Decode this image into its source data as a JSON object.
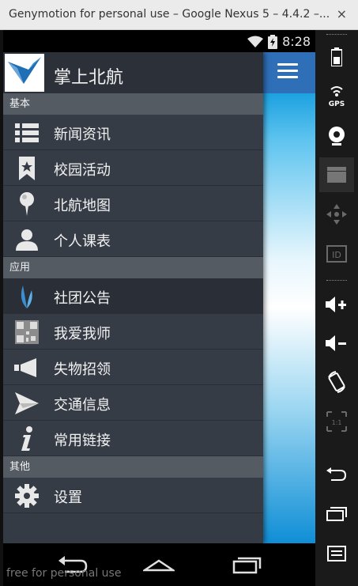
{
  "window": {
    "title": "Genymotion for personal use – Google Nexus 5 – 4.4.2 –...",
    "close_label": "×"
  },
  "status_bar": {
    "time": "8:28",
    "icons": [
      "wifi-icon",
      "battery-charging-icon"
    ]
  },
  "app": {
    "title": "掌上北航",
    "menu_button": "hamburger-icon"
  },
  "drawer": {
    "sections": [
      {
        "header": "基本",
        "items": [
          {
            "label": "新闻资讯",
            "icon": "list-icon"
          },
          {
            "label": "校园活动",
            "icon": "bookmark-star-icon"
          },
          {
            "label": "北航地图",
            "icon": "map-pin-icon"
          },
          {
            "label": "个人课表",
            "icon": "person-icon"
          }
        ]
      },
      {
        "header": "应用",
        "items": [
          {
            "label": "社团公告",
            "icon": "leaf-icon",
            "active": true
          },
          {
            "label": "我爱我师",
            "icon": "qr-code-icon"
          },
          {
            "label": "失物招领",
            "icon": "megaphone-icon"
          },
          {
            "label": "交通信息",
            "icon": "paper-plane-icon"
          },
          {
            "label": "常用链接",
            "icon": "info-icon"
          }
        ]
      },
      {
        "header": "其他",
        "items": [
          {
            "label": "设置",
            "icon": "gear-icon"
          }
        ]
      }
    ]
  },
  "nav_bar": {
    "buttons": [
      "back-icon",
      "home-icon",
      "recents-icon"
    ],
    "watermark": "free for personal use"
  },
  "side_toolbar": {
    "buttons": [
      {
        "icon": "battery-icon"
      },
      {
        "icon": "gps-icon",
        "label": "GPS"
      },
      {
        "icon": "webcam-icon"
      },
      {
        "icon": "clapperboard-icon"
      },
      {
        "icon": "dpad-icon"
      },
      {
        "icon": "id-icon",
        "label": "ID"
      },
      {
        "icon": "volume-up-icon"
      },
      {
        "icon": "volume-down-icon"
      },
      {
        "icon": "rotate-icon"
      },
      {
        "icon": "scale-icon",
        "label": "1:1"
      },
      {
        "icon": "back-icon"
      },
      {
        "icon": "recents-icon"
      },
      {
        "icon": "menu-icon"
      }
    ]
  },
  "colors": {
    "drawer_bg": "#353b45",
    "section_bg": "#555b63",
    "appbar": "#2f6fb8",
    "accent": "#1aa0e0"
  }
}
